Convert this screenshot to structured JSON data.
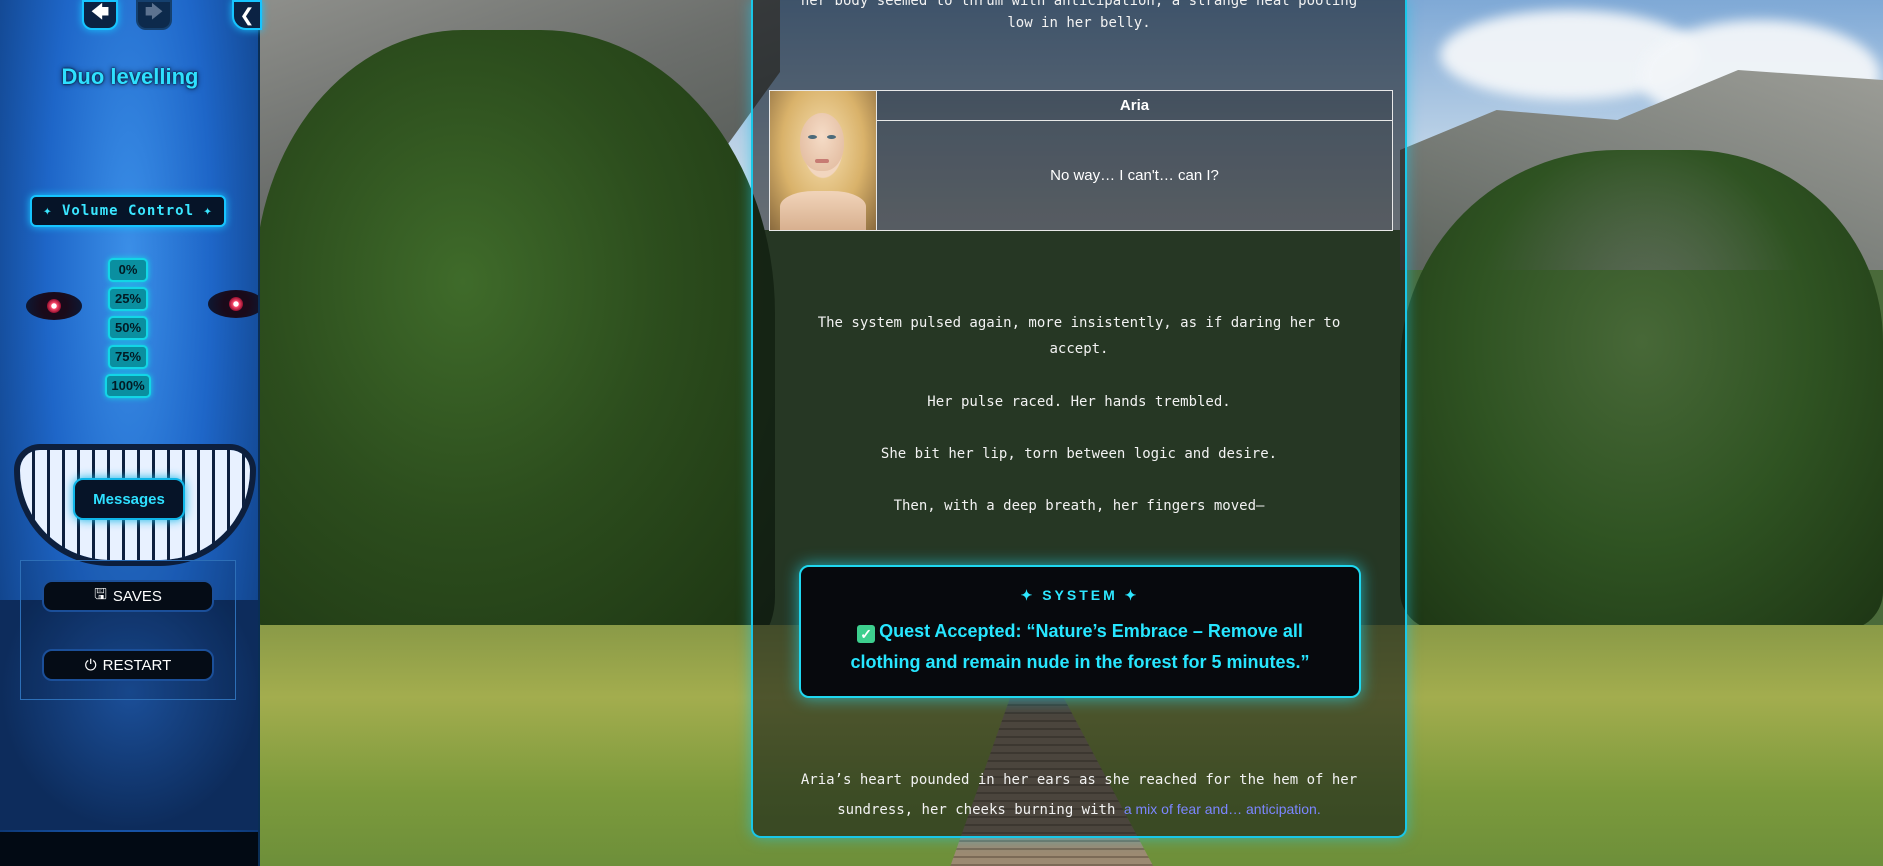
{
  "app": {
    "title": "Duo levelling"
  },
  "nav": {
    "back_icon": "arrow-left-icon",
    "forward_icon": "arrow-right-icon",
    "collapse_icon": "chevron-left-icon"
  },
  "volume": {
    "title": "✦ Volume Control ✦",
    "options": [
      "0%",
      "25%",
      "50%",
      "75%",
      "100%"
    ]
  },
  "sidebar": {
    "messages_label": "Messages",
    "saves_label": "SAVES",
    "restart_label": "RESTART"
  },
  "story": {
    "top_line_1": "her body seemed to thrum with anticipation, a strange heat pooling",
    "top_line_2": "low in her belly.",
    "dialogue": {
      "name": "Aria",
      "text": "No way… I can't… can I?"
    },
    "para_1_line_1": "The system pulsed again, more insistently, as if daring her to",
    "para_1_line_2": "accept.",
    "para_2": "Her pulse raced. Her hands trembled.",
    "para_3": "She bit her lip, torn between logic and desire.",
    "para_4": "Then, with a deep breath, her fingers moved—",
    "system": {
      "title": "✦ SYSTEM ✦",
      "body": "Quest Accepted: “Nature’s Embrace – Remove all clothing and remain nude in the forest for 5 minutes.”"
    },
    "para_5_line_1": "Aria’s heart pounded in her ears as she reached for the hem of her",
    "para_5_line_2": "sundress, her cheeks burning with",
    "para_5_link": "a mix of fear and… anticipation."
  },
  "colors": {
    "accent": "#19c7e8",
    "system_text": "#27e6ff",
    "link": "#7b86ff"
  }
}
